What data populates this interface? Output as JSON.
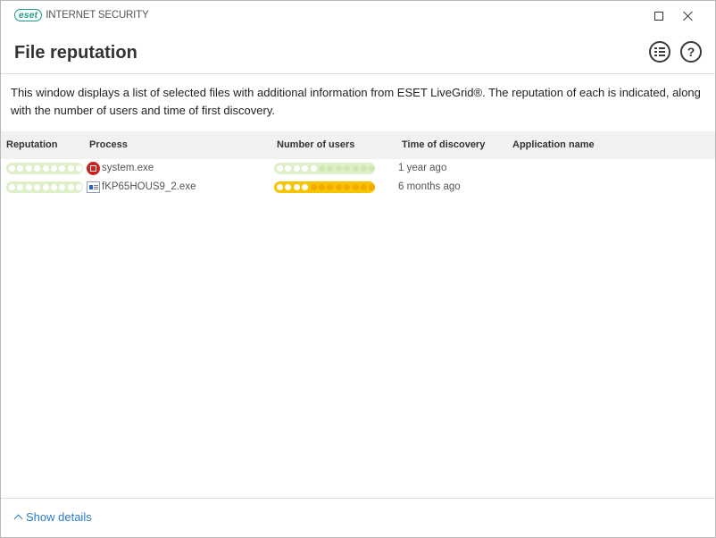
{
  "titlebar": {
    "logo_text": "eset",
    "product_name": "INTERNET SECURITY",
    "maximize_icon": "maximize-icon",
    "close_icon": "close-icon"
  },
  "header": {
    "title": "File reputation",
    "list_icon": "list-icon",
    "help_icon": "help-icon",
    "help_glyph": "?"
  },
  "description": "This window displays a list of selected files with additional information from ESET LiveGrid®. The reputation of each is indicated, along with the number of users and time of first discovery.",
  "table": {
    "columns": [
      "Reputation",
      "Process",
      "Number of users",
      "Time of discovery",
      "Application name"
    ],
    "rows": [
      {
        "reputation_level": 9,
        "reputation_max": 9,
        "process": "system.exe",
        "process_icon": "system-process-icon",
        "users_level": 5,
        "users_max": 12,
        "users_color": "#dff0c9",
        "time": "1 year ago",
        "app_name": ""
      },
      {
        "reputation_level": 9,
        "reputation_max": 9,
        "process": "fKP65HOUS9_2.exe",
        "process_icon": "executable-file-icon",
        "users_level": 4,
        "users_max": 12,
        "users_color": "#f7c400",
        "time": "6 months ago",
        "app_name": ""
      }
    ]
  },
  "footer": {
    "show_details": "Show details",
    "chevron_icon": "chevron-up-icon"
  },
  "colors": {
    "brand": "#1a9a8c",
    "link": "#2b7cc4",
    "reputation_good": "#dff0c9",
    "users_warning": "#f7c400"
  }
}
